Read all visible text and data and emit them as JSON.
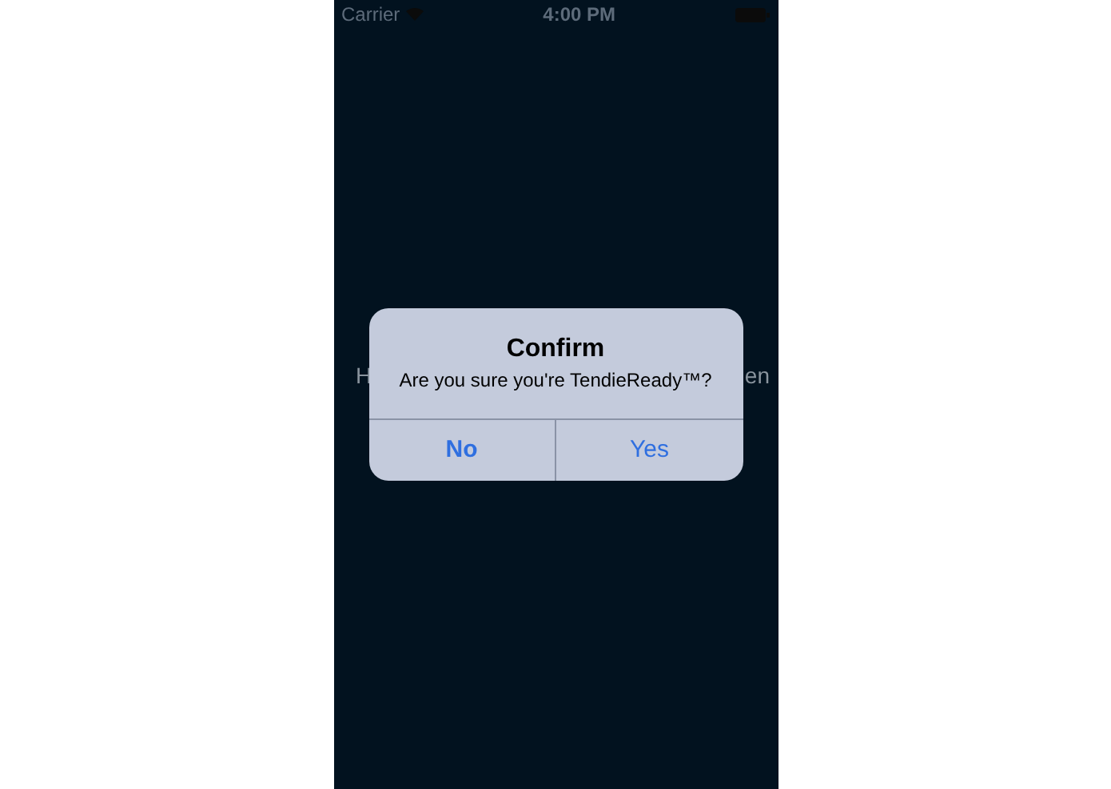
{
  "status_bar": {
    "carrier": "Carrier",
    "time": "4:00 PM"
  },
  "background_text": {
    "left": "H",
    "right": "en"
  },
  "alert": {
    "title": "Confirm",
    "message": "Are you sure you're TendieReady™?",
    "buttons": [
      {
        "label": "No",
        "bold": true
      },
      {
        "label": "Yes",
        "bold": false
      }
    ]
  }
}
